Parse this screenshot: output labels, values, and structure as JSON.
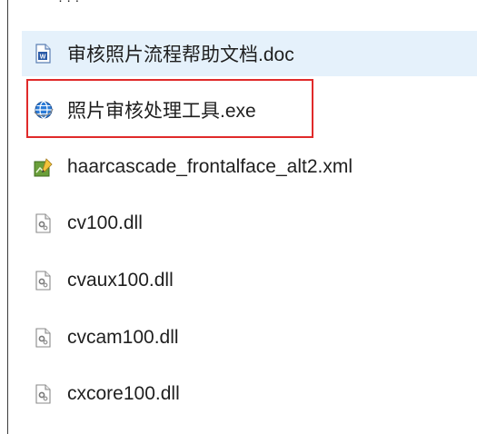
{
  "colors": {
    "highlight_border": "#e02a2a",
    "selected_row": "#e5f1fb",
    "text": "#1f1f1f"
  },
  "files": [
    {
      "name": "审核照片流程帮助文档.doc",
      "icon": "word-doc-icon"
    },
    {
      "name": "照片审核处理工具.exe",
      "icon": "globe-exe-icon"
    },
    {
      "name": "haarcascade_frontalface_alt2.xml",
      "icon": "xml-file-icon"
    },
    {
      "name": "cv100.dll",
      "icon": "dll-gear-icon"
    },
    {
      "name": "cvaux100.dll",
      "icon": "dll-gear-icon"
    },
    {
      "name": "cvcam100.dll",
      "icon": "dll-gear-icon"
    },
    {
      "name": "cxcore100.dll",
      "icon": "dll-gear-icon"
    }
  ]
}
